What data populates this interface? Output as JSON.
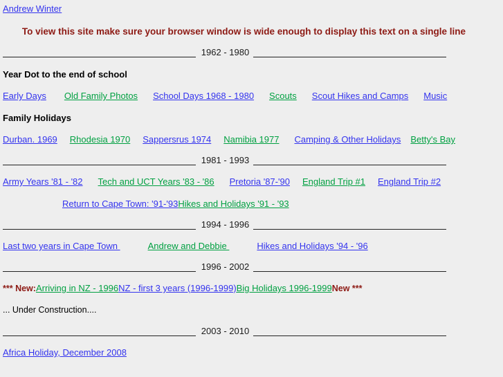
{
  "colors": {
    "background": "#eeeeee",
    "link_blue": "#3333ee",
    "link_green": "#00a041",
    "notice_red": "#8d1a14",
    "text_black": "#000000",
    "rule": "#222222"
  },
  "header": {
    "home_link": "Andrew Winter",
    "notice": "To view this site make sure your browser window is wide enough to display this text on a single line"
  },
  "sections": [
    {
      "divider_label": "1962 - 1980",
      "headings": [
        {
          "text": "Year Dot to the end of school"
        },
        {
          "text": "Family Holidays"
        }
      ],
      "rows": [
        {
          "links": [
            {
              "label": "Early Days",
              "color": "blue"
            },
            {
              "label": "Old Family Photos",
              "color": "green"
            },
            {
              "label": "School Days 1968 - 1980",
              "color": "blue"
            },
            {
              "label": "Scouts",
              "color": "green"
            },
            {
              "label": "Scout Hikes and Camps",
              "color": "blue"
            },
            {
              "label": "Music",
              "color": "blue"
            }
          ]
        },
        {
          "links": [
            {
              "label": "Durban. 1969",
              "color": "blue"
            },
            {
              "label": "Rhodesia 1970",
              "color": "green"
            },
            {
              "label": "Sappersrus 1974",
              "color": "blue"
            },
            {
              "label": "Namibia 1977",
              "color": "green"
            },
            {
              "label": "Camping & Other Holidays",
              "color": "blue"
            },
            {
              "label": "Betty's Bay",
              "color": "green"
            }
          ]
        }
      ]
    },
    {
      "divider_label": "1981 - 1993",
      "rows": [
        {
          "links": [
            {
              "label": "Army Years '81 - '82",
              "color": "blue"
            },
            {
              "label": "Tech and UCT Years '83 - '86",
              "color": "green"
            },
            {
              "label": "Pretoria '87-'90",
              "color": "blue"
            },
            {
              "label": "England Trip #1",
              "color": "green"
            },
            {
              "label": "England Trip #2",
              "color": "blue"
            }
          ]
        },
        {
          "links": [
            {
              "label": "Return to Cape Town: '91-'93",
              "color": "blue"
            },
            {
              "label": "Hikes and Holidays '91 - '93",
              "color": "green"
            }
          ]
        }
      ]
    },
    {
      "divider_label": "1994 - 1996",
      "rows": [
        {
          "links": [
            {
              "label": "Last two years in Cape Town ",
              "color": "blue"
            },
            {
              "label": "Andrew and Debbie ",
              "color": "green"
            },
            {
              "label": "Hikes and Holidays '94 - '96",
              "color": "blue"
            }
          ]
        }
      ]
    },
    {
      "divider_label": "1996 - 2002",
      "new_prefix": "*** New:",
      "new_suffix": "New ***",
      "rows": [
        {
          "links": [
            {
              "label": "Arriving in NZ - 1996",
              "color": "green"
            },
            {
              "label": "NZ - first 3 years (1996-1999)",
              "color": "blue"
            },
            {
              "label": "Big Holidays 1996-1999",
              "color": "green"
            }
          ]
        }
      ],
      "construction": "... Under Construction...."
    },
    {
      "divider_label": "2003 - 2010",
      "rows": [
        {
          "links": [
            {
              "label": "Africa Holiday, December 2008",
              "color": "blue"
            }
          ]
        }
      ]
    }
  ]
}
